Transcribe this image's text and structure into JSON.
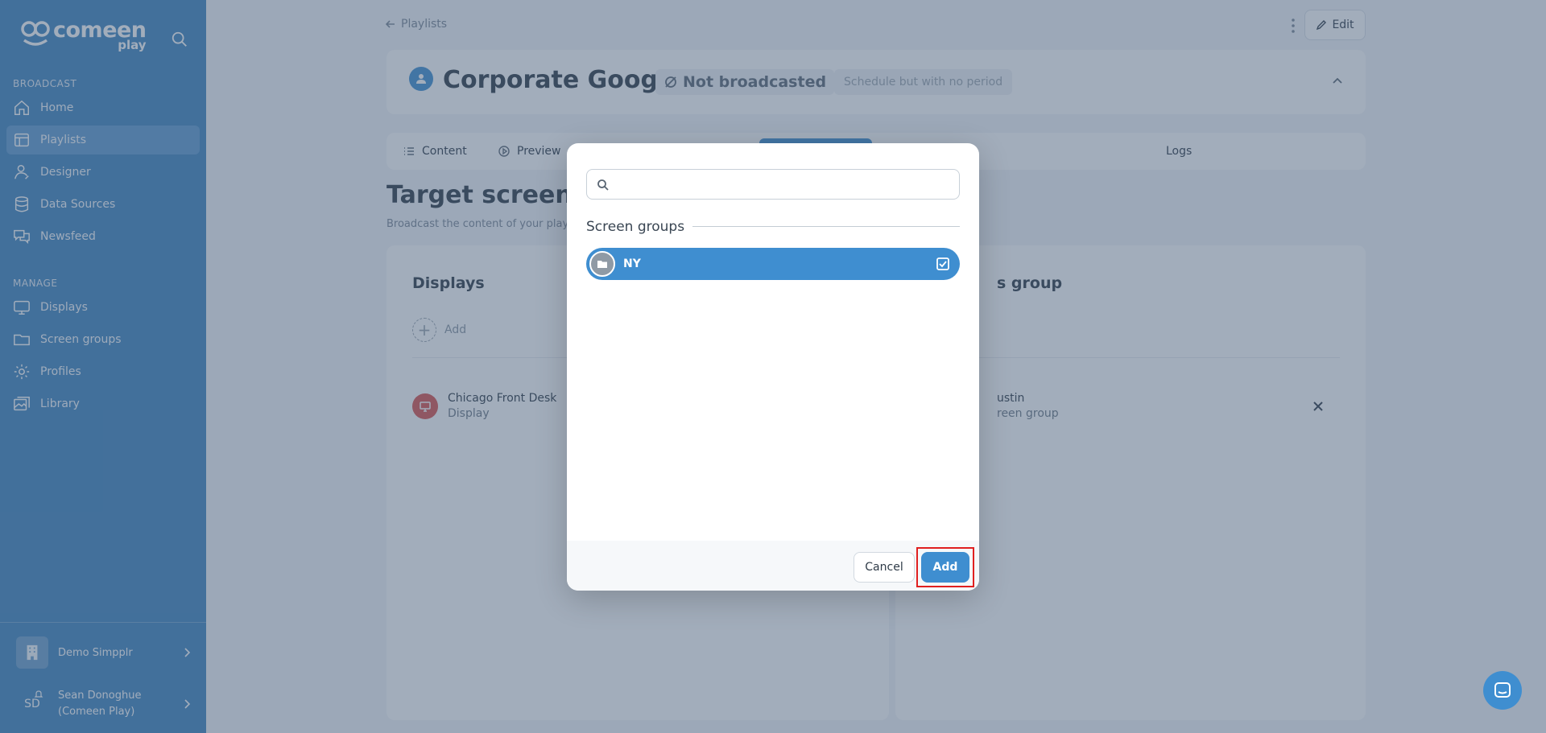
{
  "sidebar": {
    "logo_main": "comeen",
    "logo_sub": "play",
    "sections": {
      "broadcast": "BROADCAST",
      "manage": "MANAGE"
    },
    "broadcast_items": [
      {
        "label": "Home",
        "icon": "home-icon"
      },
      {
        "label": "Playlists",
        "icon": "playlist-icon"
      },
      {
        "label": "Designer",
        "icon": "designer-icon"
      },
      {
        "label": "Data Sources",
        "icon": "database-icon"
      },
      {
        "label": "Newsfeed",
        "icon": "chat-bubbles-icon"
      }
    ],
    "manage_items": [
      {
        "label": "Displays",
        "icon": "monitor-icon"
      },
      {
        "label": "Screen groups",
        "icon": "folder-icon"
      },
      {
        "label": "Profiles",
        "icon": "gear-icon"
      },
      {
        "label": "Library",
        "icon": "images-icon"
      }
    ],
    "org_name": "Demo Simpplr",
    "user_initials": "SD",
    "user_name_1": "Sean Donoghue",
    "user_name_2": "(Comeen Play)"
  },
  "page": {
    "back_label": "Playlists",
    "edit_label": "Edit",
    "title": "Corporate Google",
    "status": "Not broadcasted",
    "schedule_note": "Schedule but with no period",
    "tabs": [
      {
        "label": "Content",
        "icon": "list-icon"
      },
      {
        "label": "Preview",
        "icon": "play-circle-icon"
      },
      {
        "label": "Logs",
        "icon": "clock-icon"
      }
    ],
    "heading": "Target screens",
    "subheading": "Broadcast the content of your playlis",
    "displays_panel": {
      "title": "Displays",
      "add_label": "Add",
      "row_title": "Chicago Front Desk",
      "row_subtitle": "Display"
    },
    "groups_panel": {
      "title": "s group",
      "row_title": "ustin",
      "row_subtitle": "reen group"
    }
  },
  "modal": {
    "search_placeholder": "",
    "search_value": "",
    "group_heading": "Screen groups",
    "items": [
      {
        "label": "NY",
        "selected": true
      }
    ],
    "cancel_label": "Cancel",
    "add_label": "Add"
  },
  "colors": {
    "sidebar": "#3f84bf",
    "accent": "#3f8ed0",
    "highlight": "#e02020",
    "display_icon": "#d9534f"
  }
}
